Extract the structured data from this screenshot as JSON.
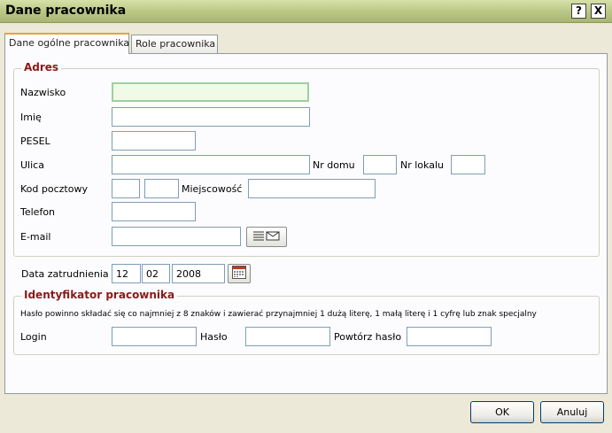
{
  "window": {
    "title": "Dane pracownika",
    "help_label": "?",
    "close_label": "X"
  },
  "tabs": [
    {
      "label": "Dane ogólne pracownika",
      "active": true
    },
    {
      "label": "Role pracownika",
      "active": false
    }
  ],
  "address": {
    "legend": "Adres",
    "surname_label": "Nazwisko",
    "surname_value": "",
    "firstname_label": "Imię",
    "firstname_value": "",
    "pesel_label": "PESEL",
    "pesel_value": "",
    "street_label": "Ulica",
    "street_value": "",
    "house_no_label": "Nr domu",
    "house_no_value": "",
    "apartment_no_label": "Nr lokalu",
    "apartment_no_value": "",
    "postal_code_label": "Kod pocztowy",
    "postal_code_part1": "",
    "postal_code_part2": "",
    "city_label": "Miejscowość",
    "city_value": "",
    "phone_label": "Telefon",
    "phone_value": "",
    "email_label": "E-mail",
    "email_value": ""
  },
  "employment": {
    "date_label": "Data zatrudnienia",
    "day": "12",
    "month": "02",
    "year": "2008"
  },
  "identifier": {
    "legend": "Identyfikator pracownika",
    "hint": "Hasło powinno składać się co najmniej z 8 znaków i zawierać przynajmniej 1 dużą literę, 1 małą literę i 1 cyfrę lub znak specjalny",
    "login_label": "Login",
    "login_value": "",
    "password_label": "Hasło",
    "password_value": "",
    "password_repeat_label": "Powtórz hasło",
    "password_repeat_value": ""
  },
  "buttons": {
    "ok_label": "OK",
    "cancel_label": "Anuluj"
  },
  "icons": {
    "email_button": "envelope-list-icon",
    "calendar_button": "calendar-icon"
  }
}
